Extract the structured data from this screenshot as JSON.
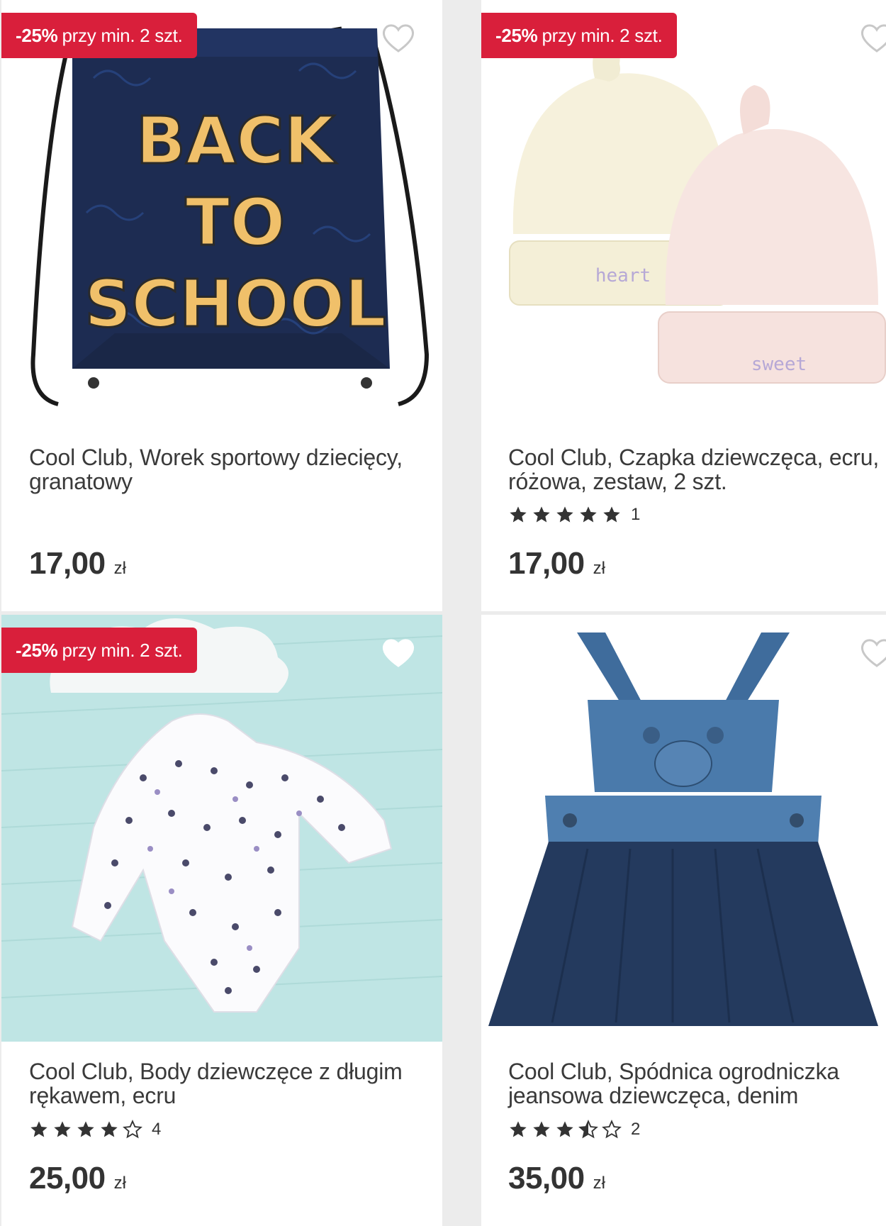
{
  "products": [
    {
      "promo": {
        "percent": "-25%",
        "text": "przy min. 2 szt."
      },
      "title": "Cool Club, Worek sportowy dziecięcy, granatowy",
      "image_text": [
        "BACK",
        "TO",
        "SCHOOL"
      ],
      "rating": null,
      "price": "17,00",
      "currency": "zł"
    },
    {
      "promo": {
        "percent": "-25%",
        "text": "przy min. 2 szt."
      },
      "title": "Cool Club, Czapka dziewczęca, ecru, różowa, zestaw, 2 szt.",
      "image_text": [
        "heart",
        "sweet"
      ],
      "rating": {
        "stars": 5,
        "count": "1"
      },
      "price": "17,00",
      "currency": "zł"
    },
    {
      "promo": {
        "percent": "-25%",
        "text": "przy min. 2 szt."
      },
      "title": "Cool Club, Body dziewczęce z długim rękawem, ecru",
      "rating": {
        "stars": 4,
        "count": "4"
      },
      "price": "25,00",
      "currency": "zł"
    },
    {
      "promo": null,
      "title": "Cool Club, Spódnica ogrodniczka jeansowa dziewczęca, denim",
      "rating": {
        "stars": 3.5,
        "count": "2"
      },
      "price": "35,00",
      "currency": "zł"
    }
  ],
  "colors": {
    "promo_bg": "#d91f3b",
    "card_bg": "#ffffff",
    "grid_bg": "#ececec",
    "star": "#333333"
  },
  "icons": {
    "wishlist": "heart-outline-icon",
    "star_full": "star-icon",
    "star_half": "star-half-icon",
    "star_empty": "star-outline-icon"
  }
}
